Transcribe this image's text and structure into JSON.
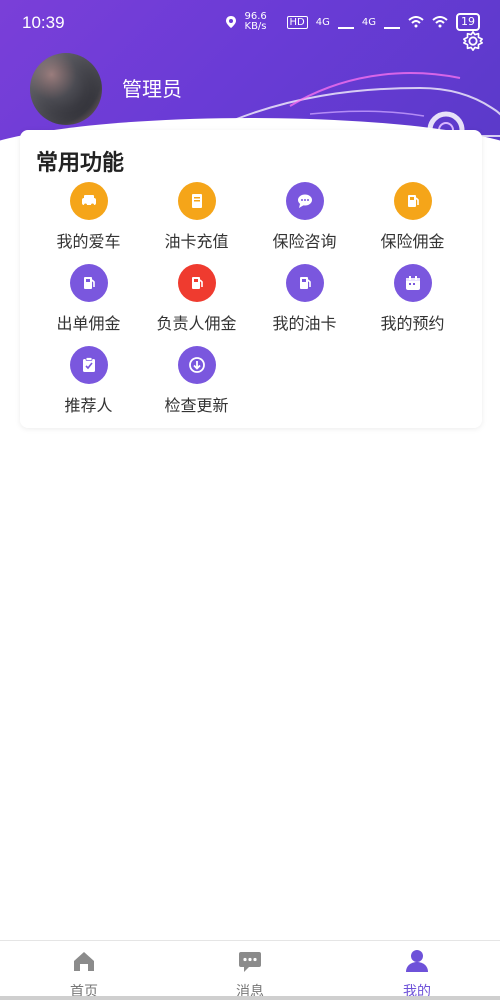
{
  "status": {
    "time": "10:39",
    "net_speed": "96.6 KB/s",
    "hd": "HD",
    "signal_1": "4G",
    "signal_2": "4G",
    "battery": "19"
  },
  "profile": {
    "username": "管理员"
  },
  "functions": {
    "title": "常用功能",
    "items": [
      {
        "label": "我的爱车",
        "icon": "car-icon",
        "color": "#f5a519"
      },
      {
        "label": "油卡充值",
        "icon": "fuel-card-icon",
        "color": "#f5a519"
      },
      {
        "label": "保险咨询",
        "icon": "chat-icon",
        "color": "#7a57de"
      },
      {
        "label": "保险佣金",
        "icon": "fuel-pump-icon",
        "color": "#f5a519"
      },
      {
        "label": "出单佣金",
        "icon": "fuel-pump-icon",
        "color": "#7a57de"
      },
      {
        "label": "负责人佣金",
        "icon": "fuel-pump-icon",
        "color": "#ef3b2f"
      },
      {
        "label": "我的油卡",
        "icon": "fuel-pump-icon",
        "color": "#7a57de"
      },
      {
        "label": "我的预约",
        "icon": "calendar-icon",
        "color": "#7a57de"
      },
      {
        "label": "推荐人",
        "icon": "clipboard-icon",
        "color": "#7a57de"
      },
      {
        "label": "检查更新",
        "icon": "download-icon",
        "color": "#7a57de"
      }
    ]
  },
  "tabs": [
    {
      "label": "首页",
      "icon": "home-icon",
      "active": false
    },
    {
      "label": "消息",
      "icon": "message-icon",
      "active": false
    },
    {
      "label": "我的",
      "icon": "user-icon",
      "active": true
    }
  ]
}
